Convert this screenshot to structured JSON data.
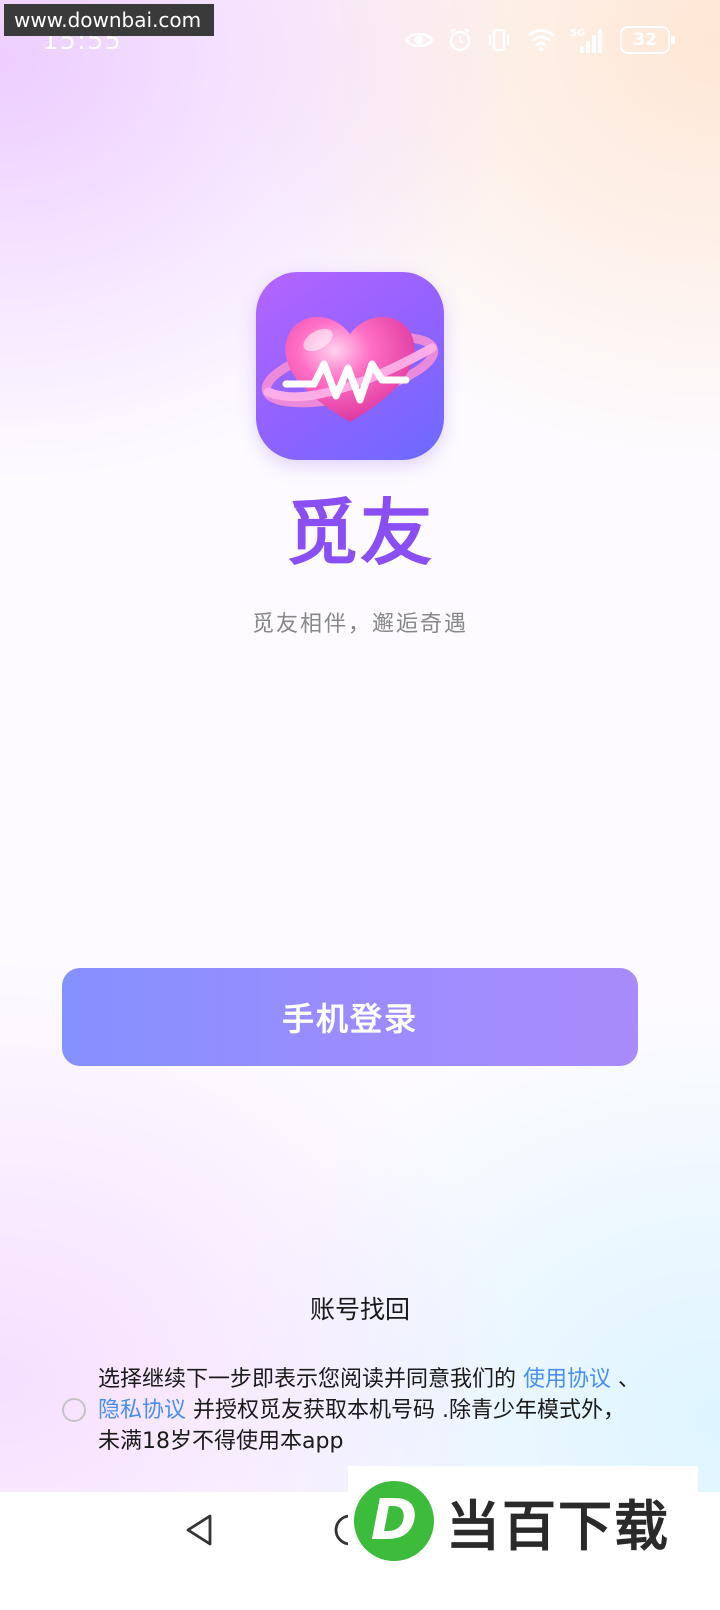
{
  "status_bar": {
    "time": "15:55",
    "battery": "32",
    "network": "5G"
  },
  "watermark_top": "www.downbai.com",
  "app": {
    "name": "觅友",
    "slogan": "觅友相伴，邂逅奇遇"
  },
  "login": {
    "button_label": "手机登录",
    "recover_label": "账号找回"
  },
  "agreement": {
    "prefix": "选择继续下一步即表示您阅读并同意我们的 ",
    "terms_link": "使用协议",
    "separator": " 、 ",
    "privacy_link": "隐私协议",
    "suffix": " 并授权觅友获取本机号码 .除青少年模式外，未满18岁不得使用本app",
    "checked": false
  },
  "watermark_bottom": {
    "logo_letter": "D",
    "text": "当百下载"
  },
  "colors": {
    "brand": "#8a4ff2",
    "button_start": "#8591ff",
    "button_end": "#a98bfa",
    "link": "#4a8ef0"
  }
}
